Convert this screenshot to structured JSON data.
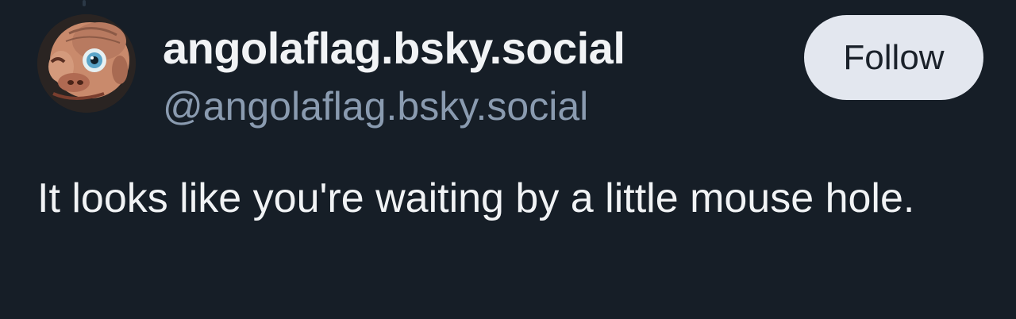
{
  "author": {
    "display_name": "angolaflag.bsky.social",
    "handle": "@angolaflag.bsky.social",
    "avatar_icon": "avatar-caricature-face"
  },
  "actions": {
    "follow_label": "Follow"
  },
  "post": {
    "text": "It looks like you're waiting by a little mouse hole."
  },
  "colors": {
    "background": "#161e27",
    "primary_text": "#f1f3f5",
    "secondary_text": "#8a9bb0",
    "follow_button_bg": "#e3e7ef"
  }
}
